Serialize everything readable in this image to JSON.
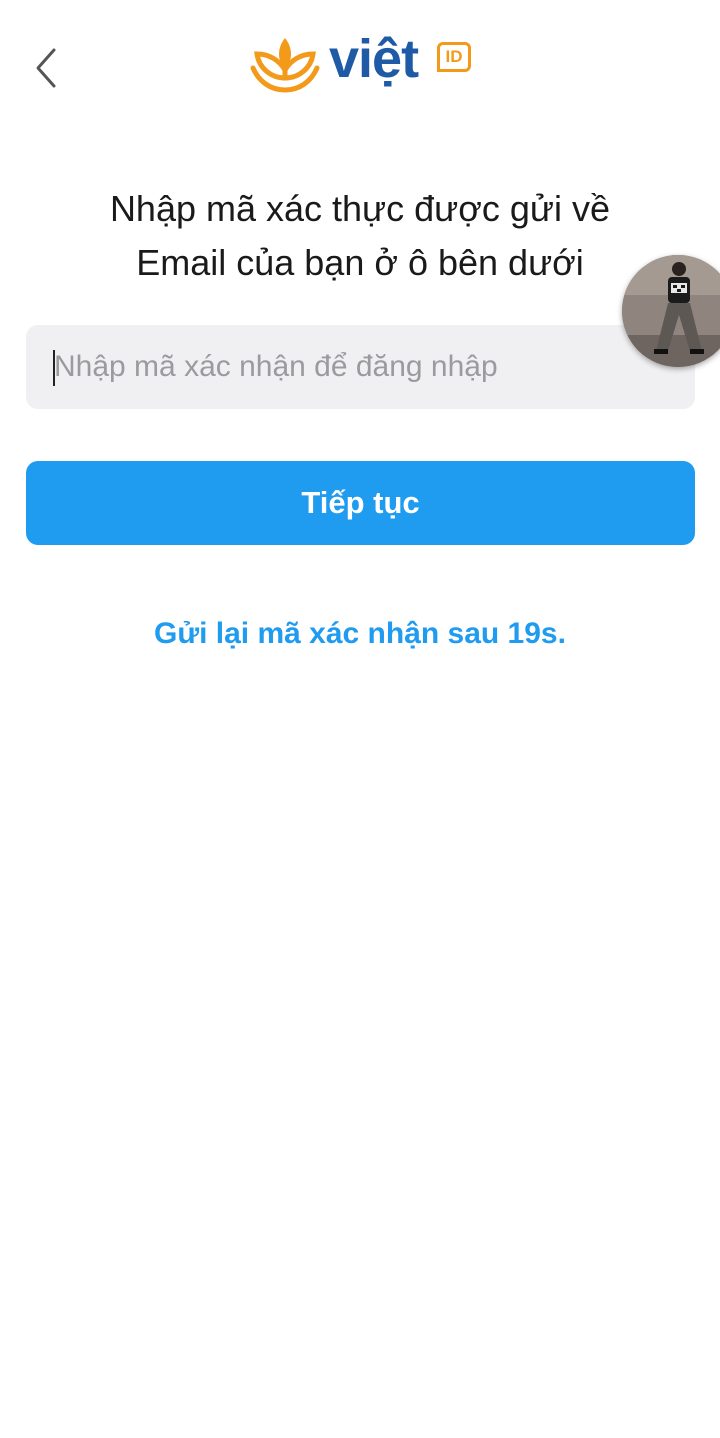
{
  "header": {
    "back_icon": "chevron-left-icon",
    "logo": {
      "word": "việt",
      "badge": "ID",
      "colors": {
        "word": "#1f5aa6",
        "accent": "#f39a1b"
      }
    }
  },
  "main": {
    "title_line1": "Nhập mã xác thực được gửi về",
    "title_line2": "Email của bạn ở ô bên dưới",
    "code_input": {
      "value": "",
      "placeholder": "Nhập mã xác nhận để đăng nhập"
    },
    "continue_label": "Tiếp tục",
    "resend_label": "Gửi lại mã xác nhận sau 19s."
  },
  "overlay": {
    "avatar": "floating-avatar-image"
  },
  "colors": {
    "primary": "#1f9bf0",
    "input_bg": "#f0f0f2",
    "text": "#1a1a1a"
  }
}
